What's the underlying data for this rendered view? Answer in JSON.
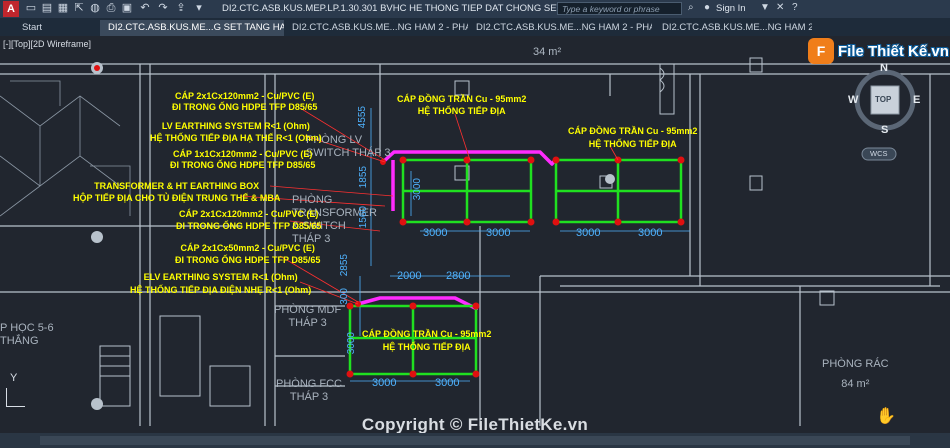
{
  "titlebar": {
    "app_logo": "A",
    "document_title": "DI2.CTC.ASB.KUS.MEP.LP.1.30.301 BVHC HE THONG TIEP DAT CHONG SET TANG HA...",
    "search_placeholder": "Type a keyword or phrase",
    "sign_in": "Sign In"
  },
  "tabs": [
    {
      "label": "Start"
    },
    {
      "label": "DI2.CTC.ASB.KUS.ME...G SET TANG HAM 2*"
    },
    {
      "label": "DI2.CTC.ASB.KUS.ME...NG HAM 2 - PHAN 1*"
    },
    {
      "label": "DI2.CTC.ASB.KUS.ME...NG HAM 2 - PHAN 2*"
    },
    {
      "label": "DI2.CTC.ASB.KUS.ME...NG HAM 2 - PHA"
    }
  ],
  "viewport": {
    "label": "[-][Top][2D Wireframe]",
    "ucs_y": "Y"
  },
  "viewcube": {
    "top": "TOP",
    "n": "N",
    "s": "S",
    "e": "E",
    "w": "W",
    "wcs": "WCS"
  },
  "watermark": {
    "logo_letter": "F",
    "logo_text": "File Thiết Kế.vn",
    "copyright": "Copyright © FileThietKe.vn"
  },
  "annotations": {
    "cap1_l1": "CÁP 2x1Cx120mm2 - Cu/PVC (E)",
    "cap1_l2": "ĐI TRONG ỐNG HDPE TFP D85/65",
    "lv_l1": "LV EARTHING SYSTEM R<1 (Ohm)",
    "lv_l2": "HỆ THỐNG TIẾP ĐỊA HẠ THẾ R<1 (Ohm)",
    "cap2_l1": "CÁP 1x1Cx120mm2 - Cu/PVC (E)",
    "cap2_l2": "ĐI TRONG ỐNG HDPE TFP D85/65",
    "tr_l1": "TRANSFORMER & HT EARTHING BOX",
    "tr_l2": "HỘP TIẾP ĐỊA CHO TỦ ĐIỆN TRUNG THẾ & MBA",
    "cap3_l1": "CÁP 2x1Cx120mm2 - Cu/PVC (E)",
    "cap3_l2": "ĐI TRONG ỐNG HDPE TFP D85/65",
    "cap4_l1": "CÁP 2x1Cx50mm2 - Cu/PVC (E)",
    "cap4_l2": "ĐI TRONG ỐNG HDPE TFP D85/65",
    "elv_l1": "ELV EARTHING SYSTEM R<1 (Ohm)",
    "elv_l2": "HỆ THỐNG TIẾP ĐỊA ĐIỆN NHẸ R<1 (Ohm)",
    "copper1_l1": "CÁP ĐỒNG TRẦN Cu - 95mm2",
    "copper1_l2": "HỆ THỐNG TIẾP ĐỊA",
    "copper2_l1": "CÁP ĐỒNG TRẦN Cu - 95mm2",
    "copper2_l2": "HỆ THỐNG TIẾP ĐỊA",
    "copper3_l1": "CÁP ĐỒNG TRẦN Cu - 95mm2",
    "copper3_l2": "HỆ THỐNG TIẾP ĐỊA"
  },
  "rooms": {
    "area_34_top": "34 m²",
    "lv_l1": "PHÒNG LV",
    "lv_l2": "SWITCH THÁP 3",
    "trans_l1": "PHÒNG",
    "trans_l2": "TRANSFORMER",
    "trans_l3": "& SWITCH",
    "trans_l4": "THÁP 3",
    "mdf_l1": "PHÒNG MDF",
    "mdf_l2": "THÁP 3",
    "fcc_l1": "PHÒNG FCC",
    "fcc_l2": "THÁP 3",
    "rac_l1": "PHÒNG RÁC",
    "rac_l2": "84 m²",
    "hoc_l1": "P HỌC 5-6",
    "hoc_l2": "THẮNG"
  },
  "dimensions": {
    "v4555": "4555",
    "v1855": "1855",
    "v1560": "1560",
    "v2855": "2855",
    "v3000a": "3000",
    "v3000b": "3000",
    "v300": "300",
    "h3000_1": "3000",
    "h3000_2": "3000",
    "h3000_3": "3000",
    "h3000_4": "3000",
    "h2000": "2000",
    "h2800": "2800",
    "h3000_5": "3000",
    "h3000_6": "3000"
  },
  "colors": {
    "wire": "#20e020",
    "cable": "#ff2bff",
    "text_yellow": "#ffff00",
    "node": "#e01010",
    "dim": "#4fb3ff",
    "wall": "#b8c2cc"
  }
}
